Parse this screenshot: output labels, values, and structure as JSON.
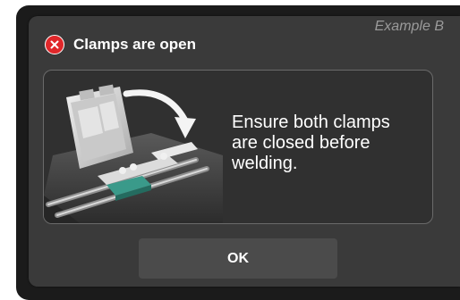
{
  "dialog": {
    "example_label": "Example B",
    "title": "Clamps are open",
    "icon": "error-x-icon",
    "message": "Ensure both clamps are closed before welding.",
    "ok_label": "OK"
  },
  "colors": {
    "dialog_bg": "#3a3a3a",
    "error_red": "#e0272a",
    "button_bg": "#4b4b4b"
  }
}
